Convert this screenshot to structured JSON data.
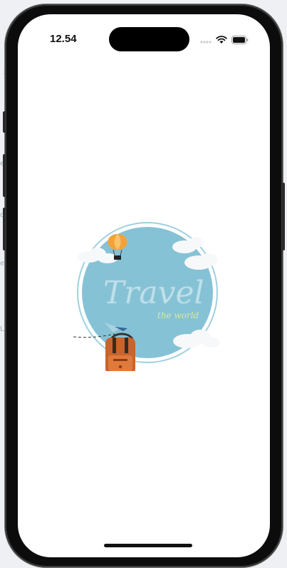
{
  "status_bar": {
    "time": "12.54"
  },
  "splash": {
    "logo_title": "Travel",
    "logo_subtitle": "the world"
  }
}
